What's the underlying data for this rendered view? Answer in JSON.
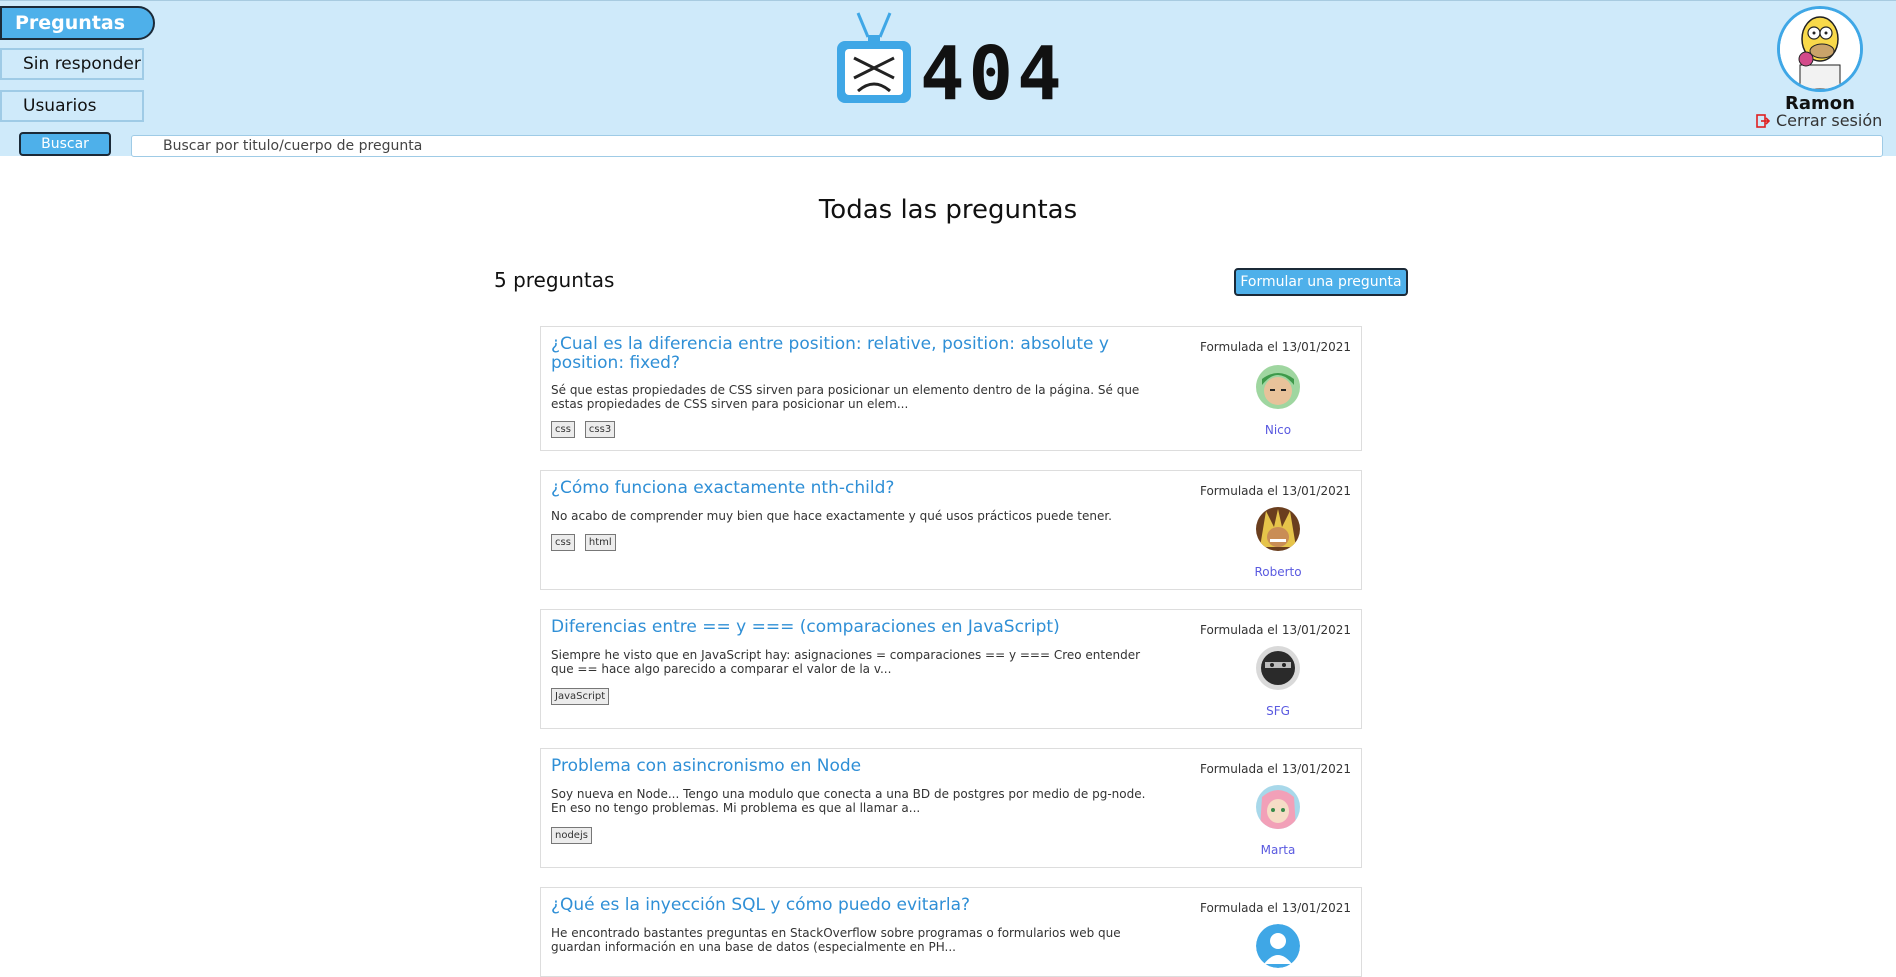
{
  "nav": {
    "questions": "Preguntas",
    "unanswered": "Sin responder",
    "users": "Usuarios"
  },
  "search": {
    "button": "Buscar",
    "placeholder": "Buscar por titulo/cuerpo de pregunta"
  },
  "logo": {
    "text": "404",
    "icon": "tv-icon"
  },
  "user": {
    "name": "Ramon",
    "logout": "Cerrar sesión",
    "logout_icon": "logout-icon"
  },
  "main": {
    "title": "Todas las preguntas",
    "count": "5 preguntas",
    "ask_button": "Formular una pregunta"
  },
  "questions": [
    {
      "title": "¿Cual es la diferencia entre position: relative, position: absolute y position: fixed?",
      "body": "Sé que estas propiedades de CSS sirven para posicionar un elemento dentro de la página. Sé que estas propiedades de CSS sirven para posicionar un elem...",
      "tags": [
        "css",
        "css3"
      ],
      "date": "Formulada el 13/01/2021",
      "author": "Nico"
    },
    {
      "title": "¿Cómo funciona exactamente nth-child?",
      "body": "No acabo de comprender muy bien que hace exactamente y qué usos prácticos puede tener.",
      "tags": [
        "css",
        "html"
      ],
      "date": "Formulada el 13/01/2021",
      "author": "Roberto"
    },
    {
      "title": "Diferencias entre == y === (comparaciones en JavaScript)",
      "body": "Siempre he visto que en JavaScript hay: asignaciones = comparaciones == y === Creo entender que == hace algo parecido a comparar el valor de la v...",
      "tags": [
        "JavaScript"
      ],
      "date": "Formulada el 13/01/2021",
      "author": "SFG"
    },
    {
      "title": "Problema con asincronismo en Node",
      "body": "Soy nueva en Node... Tengo una modulo que conecta a una BD de postgres por medio de pg-node. En eso no tengo problemas. Mi problema es que al llamar a...",
      "tags": [
        "nodejs"
      ],
      "date": "Formulada el 13/01/2021",
      "author": "Marta"
    },
    {
      "title": "¿Qué es la inyección SQL y cómo puedo evitarla?",
      "body": "He encontrado bastantes preguntas en StackOverflow sobre programas o formularios web que guardan información en una base de datos (especialmente en PH...",
      "tags": [],
      "date": "Formulada el 13/01/2021",
      "author": ""
    }
  ],
  "colors": {
    "header_bg": "#cfeafa",
    "accent": "#4eb0ea",
    "link": "#2f8fd6",
    "author": "#5a5ae0"
  }
}
